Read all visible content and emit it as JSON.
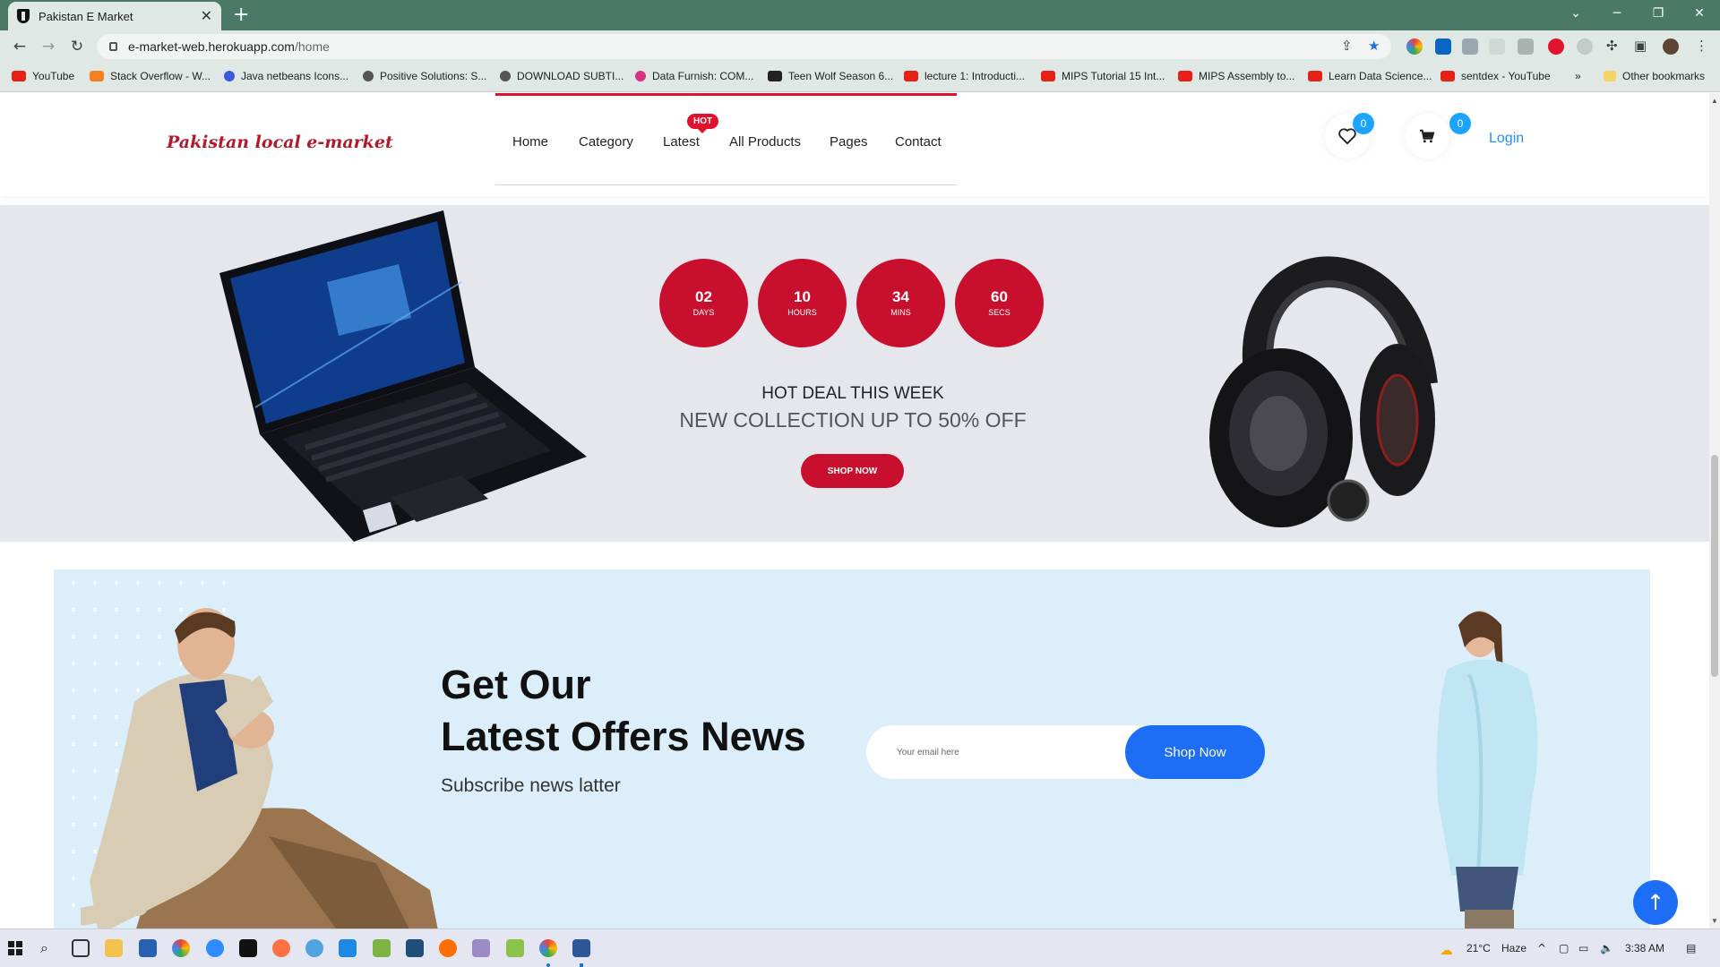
{
  "browser": {
    "tab_title": "Pakistan E Market",
    "url_host": "e-market-web.herokuapp.com",
    "url_path": "/home",
    "bookmarks": [
      {
        "label": "YouTube",
        "color": "#e62117"
      },
      {
        "label": "Stack Overflow - W...",
        "color": "#f48024"
      },
      {
        "label": "Java netbeans Icons...",
        "color": "#3b5bdb"
      },
      {
        "label": "Positive Solutions: S...",
        "color": "#555555"
      },
      {
        "label": "DOWNLOAD SUBTI...",
        "color": "#555555"
      },
      {
        "label": "Data Furnish: COM...",
        "color": "#d63384"
      },
      {
        "label": "Teen Wolf Season 6...",
        "color": "#222222"
      },
      {
        "label": "lecture 1: Introducti...",
        "color": "#e62117"
      },
      {
        "label": "MIPS Tutorial 15 Int...",
        "color": "#e62117"
      },
      {
        "label": "MIPS Assembly to...",
        "color": "#e62117"
      },
      {
        "label": "Learn Data Science...",
        "color": "#e62117"
      },
      {
        "label": "sentdex - YouTube",
        "color": "#e62117"
      }
    ],
    "bookmarks_more": "»",
    "other_bookmarks": "Other bookmarks"
  },
  "header": {
    "logo": "Pakistan local e-market",
    "nav": [
      "Home",
      "Category",
      "Latest",
      "All Products",
      "Pages",
      "Contact"
    ],
    "hot_badge": "HOT",
    "wishlist_count": "0",
    "cart_count": "0",
    "login": "Login"
  },
  "deal": {
    "timer": [
      {
        "value": "02",
        "unit": "DAYS"
      },
      {
        "value": "10",
        "unit": "HOURS"
      },
      {
        "value": "34",
        "unit": "MINS"
      },
      {
        "value": "60",
        "unit": "SECS"
      }
    ],
    "heading": "HOT DEAL THIS WEEK",
    "subheading": "NEW COLLECTION UP TO 50% OFF",
    "button": "SHOP NOW"
  },
  "newsletter": {
    "title_line1": "Get Our",
    "title_line2": "Latest Offers News",
    "subtitle": "Subscribe news latter",
    "email_placeholder": "Your email here",
    "button": "Shop Now"
  },
  "taskbar": {
    "temperature": "21°C",
    "weather": "Haze",
    "time": "3:38 AM"
  },
  "colors": {
    "accent_red": "#c8102e",
    "accent_blue": "#1d6ef5",
    "badge_blue": "#1aa3ff",
    "tab_strip": "#4a7a67"
  }
}
